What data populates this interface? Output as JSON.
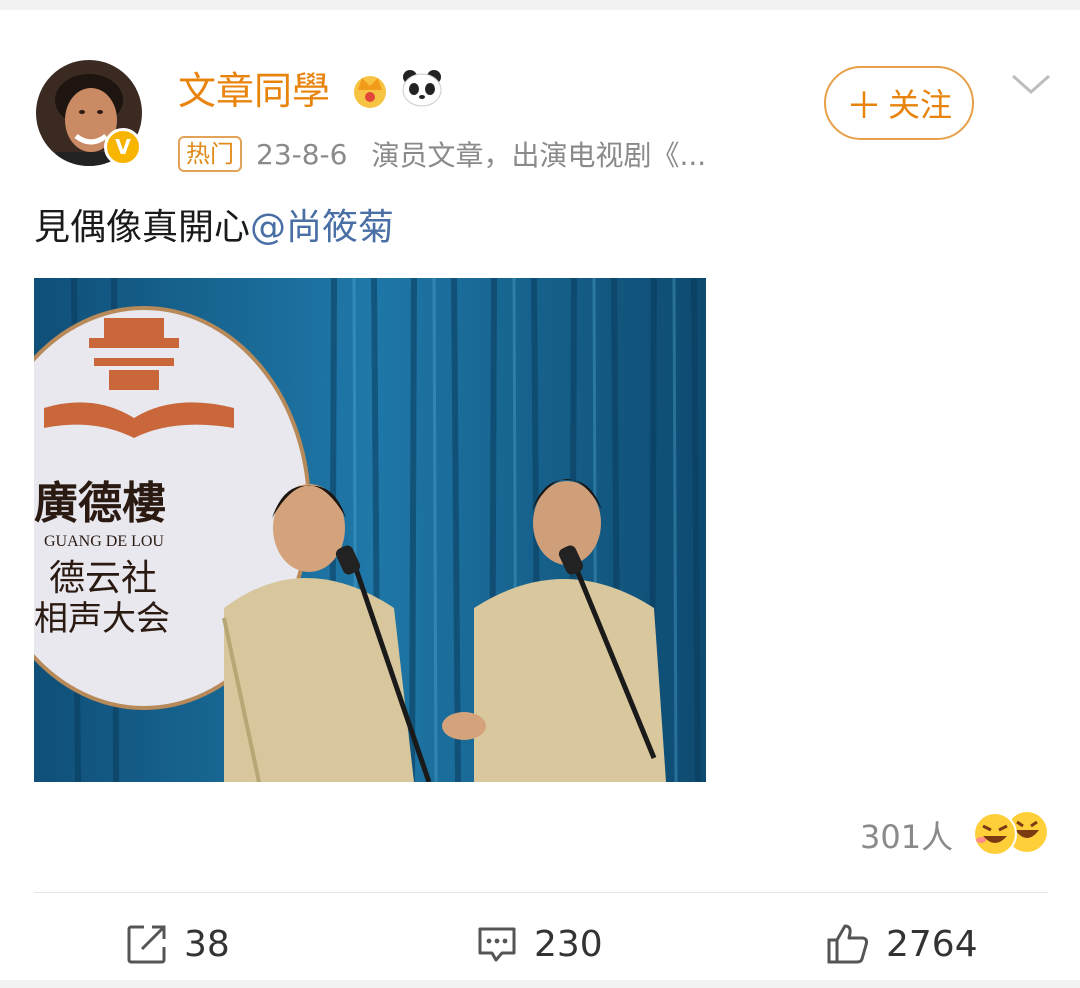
{
  "post": {
    "username": "文章同學",
    "hot_tag": "热门",
    "date": "23-8-6",
    "description": "演员文章，出演电视剧《...",
    "follow_label": "关注",
    "follow_plus": "＋",
    "text": "見偶像真開心",
    "mention": "@尚筱菊",
    "verified_mark": "V"
  },
  "photo": {
    "sign_line1": "廣德樓",
    "sign_line2": "GUANG DE LOU",
    "sign_line3": "德云社",
    "sign_line4": "相声大会"
  },
  "reactions": {
    "count": "301人"
  },
  "actions": {
    "repost_count": "38",
    "comment_count": "230",
    "like_count": "2764"
  },
  "colors": {
    "accent": "#e8830c",
    "mention": "#4a6fa5",
    "curtain": "#1c6a98"
  },
  "icons": [
    "crown-icon",
    "panda-icon",
    "chevron-down-icon",
    "share-icon",
    "comment-icon",
    "like-icon",
    "emoji-laugh-icon"
  ]
}
